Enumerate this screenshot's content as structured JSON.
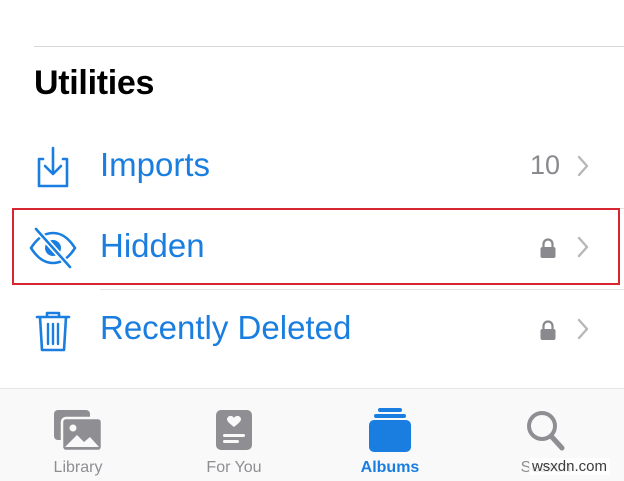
{
  "section": {
    "title": "Utilities"
  },
  "rows": [
    {
      "label": "Imports",
      "count": "10",
      "icon": "import-icon",
      "trailing": "chevron-icon"
    },
    {
      "label": "Hidden",
      "icon": "eye-slash-icon",
      "trailing": "lock-icon",
      "highlighted": true
    },
    {
      "label": "Recently Deleted",
      "icon": "trash-icon",
      "trailing": "lock-icon"
    }
  ],
  "tabbar": {
    "tabs": [
      {
        "label": "Library",
        "icon": "photo-stack-icon",
        "active": false
      },
      {
        "label": "For You",
        "icon": "memories-icon",
        "active": false
      },
      {
        "label": "Albums",
        "icon": "albums-icon",
        "active": true
      },
      {
        "label": "Search",
        "icon": "search-icon",
        "active": false
      }
    ]
  },
  "watermark": {
    "text": "wsxdn.com"
  },
  "colors": {
    "accent": "#1a7ee0",
    "secondary_text": "#8a8a8e",
    "highlight_border": "#d7262f",
    "tab_inactive": "#8e8e93"
  }
}
